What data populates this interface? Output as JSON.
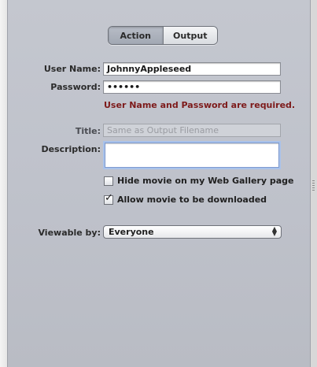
{
  "tabs": {
    "action": "Action",
    "output": "Output",
    "selected": "Action"
  },
  "form": {
    "username_label": "User Name:",
    "username_value": "JohnnyAppleseed",
    "password_label": "Password:",
    "password_value": "••••••",
    "error_text": "User Name and Password are required.",
    "title_label": "Title:",
    "title_placeholder": "Same as Output Filename",
    "description_label": "Description:",
    "description_value": "",
    "hide_movie_label": "Hide movie on my Web Gallery page",
    "hide_movie_checked": false,
    "allow_download_label": "Allow movie to be downloaded",
    "allow_download_checked": true,
    "viewable_label": "Viewable by:",
    "viewable_value": "Everyone"
  },
  "colors": {
    "panel": "#c0c3cb",
    "error": "#7d1a1a",
    "focus_ring": "#a9c2ea"
  },
  "icons": {
    "checkmark": "checkmark-icon",
    "popup_arrows": "up-down-arrows-icon",
    "resize_grip": "resize-grip-icon"
  }
}
